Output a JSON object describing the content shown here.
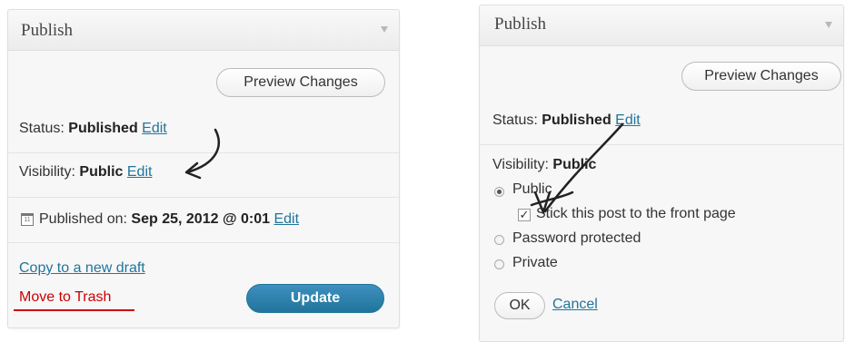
{
  "left_panel": {
    "title": "Publish",
    "preview_button": "Preview Changes",
    "status": {
      "label": "Status:",
      "value": "Published",
      "edit": "Edit"
    },
    "visibility": {
      "label": "Visibility:",
      "value": "Public",
      "edit": "Edit"
    },
    "published_on": {
      "label": "Published on:",
      "value": "Sep 25, 2012 @ 0:01",
      "edit": "Edit",
      "calendar_icon_text": "11"
    },
    "copy_link": "Copy to a new draft",
    "trash_link": "Move to Trash",
    "update_button": "Update"
  },
  "right_panel": {
    "title": "Publish",
    "preview_button": "Preview Changes",
    "status": {
      "label": "Status:",
      "value": "Published",
      "edit": "Edit"
    },
    "visibility": {
      "label": "Visibility:",
      "value": "Public"
    },
    "options": [
      {
        "label": "Public",
        "selected": true
      },
      {
        "label": "Password protected",
        "selected": false
      },
      {
        "label": "Private",
        "selected": false
      }
    ],
    "sticky_checkbox": {
      "label": "Stick this post to the front page",
      "checked": true
    },
    "ok_button": "OK",
    "cancel_link": "Cancel"
  },
  "colors": {
    "link": "#21759b",
    "trash": "#cc0000",
    "update_button": "#21759b",
    "panel_bg": "#f7f7f7"
  },
  "icons": [
    "collapse-arrow-icon",
    "calendar-icon",
    "hand-drawn-arrow-icon",
    "checkmark-icon"
  ]
}
